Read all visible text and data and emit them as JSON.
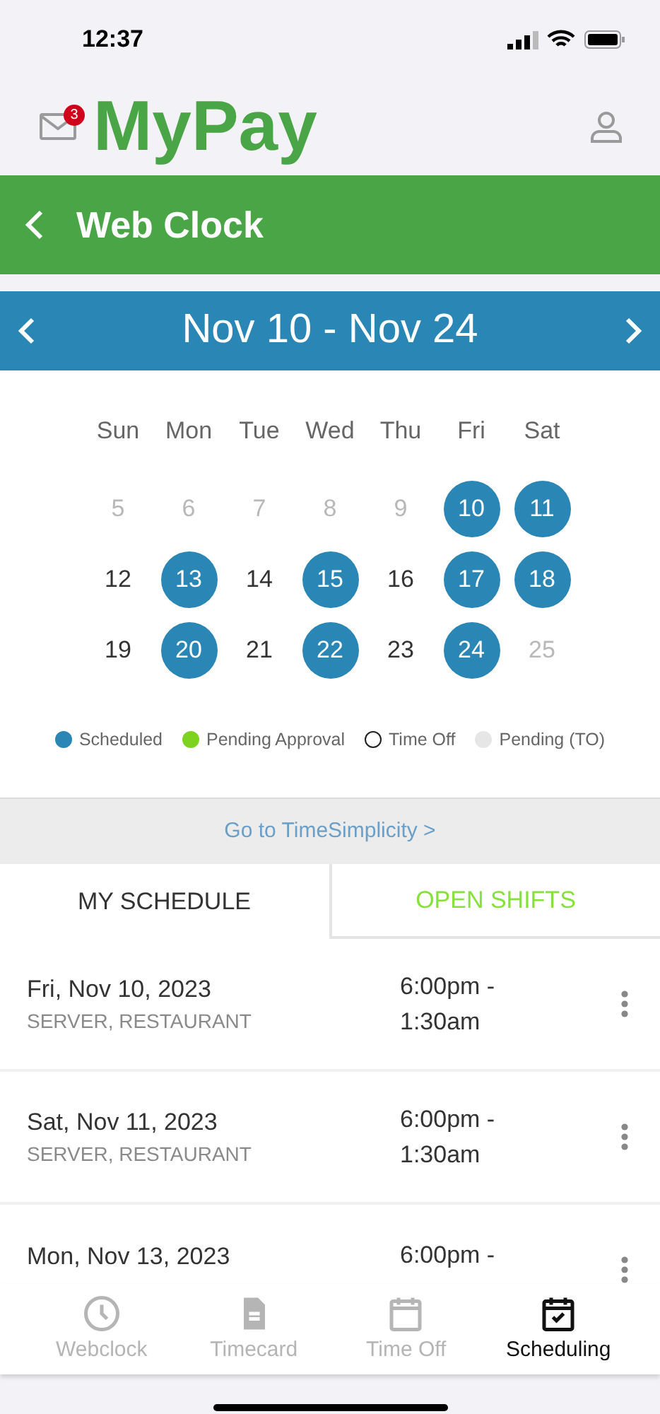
{
  "status_bar": {
    "time": "12:37"
  },
  "header": {
    "logo": "MyPay",
    "mail_badge": "3"
  },
  "title_bar": {
    "title": "Web Clock"
  },
  "range_bar": {
    "range": "Nov 10 - Nov 24"
  },
  "calendar": {
    "weekdays": [
      "Sun",
      "Mon",
      "Tue",
      "Wed",
      "Thu",
      "Fri",
      "Sat"
    ],
    "weeks": [
      [
        {
          "day": "5",
          "kind": "outside"
        },
        {
          "day": "6",
          "kind": "outside"
        },
        {
          "day": "7",
          "kind": "outside"
        },
        {
          "day": "8",
          "kind": "outside"
        },
        {
          "day": "9",
          "kind": "outside"
        },
        {
          "day": "10",
          "kind": "scheduled"
        },
        {
          "day": "11",
          "kind": "scheduled"
        }
      ],
      [
        {
          "day": "12",
          "kind": "plain"
        },
        {
          "day": "13",
          "kind": "scheduled"
        },
        {
          "day": "14",
          "kind": "plain"
        },
        {
          "day": "15",
          "kind": "scheduled"
        },
        {
          "day": "16",
          "kind": "plain"
        },
        {
          "day": "17",
          "kind": "scheduled"
        },
        {
          "day": "18",
          "kind": "scheduled"
        }
      ],
      [
        {
          "day": "19",
          "kind": "plain"
        },
        {
          "day": "20",
          "kind": "scheduled"
        },
        {
          "day": "21",
          "kind": "plain"
        },
        {
          "day": "22",
          "kind": "scheduled"
        },
        {
          "day": "23",
          "kind": "plain"
        },
        {
          "day": "24",
          "kind": "scheduled"
        },
        {
          "day": "25",
          "kind": "outside"
        }
      ]
    ],
    "legend": [
      {
        "label": "Scheduled",
        "kind": "filled",
        "color": "#2a86b4"
      },
      {
        "label": "Pending Approval",
        "kind": "filled",
        "color": "#7ed321"
      },
      {
        "label": "Time Off",
        "kind": "ring",
        "color": "#222222"
      },
      {
        "label": "Pending (TO)",
        "kind": "filled",
        "color": "#e6e6e6"
      }
    ]
  },
  "link": "Go to TimeSimplicity >",
  "tabs": [
    {
      "label": "MY SCHEDULE",
      "selected": true
    },
    {
      "label": "OPEN SHIFTS",
      "selected": false
    }
  ],
  "shifts": [
    {
      "date": "Fri, Nov 10, 2023",
      "role": "SERVER, RESTAURANT",
      "start": "6:00pm -",
      "end": "1:30am"
    },
    {
      "date": "Sat, Nov 11, 2023",
      "role": "SERVER, RESTAURANT",
      "start": "6:00pm -",
      "end": "1:30am"
    },
    {
      "date": "Mon, Nov 13, 2023",
      "start": "6:00pm -"
    }
  ],
  "bottom_nav": [
    {
      "label": "Webclock",
      "selected": false
    },
    {
      "label": "Timecard",
      "selected": false
    },
    {
      "label": "Time Off",
      "selected": false
    },
    {
      "label": "Scheduling",
      "selected": true
    }
  ]
}
